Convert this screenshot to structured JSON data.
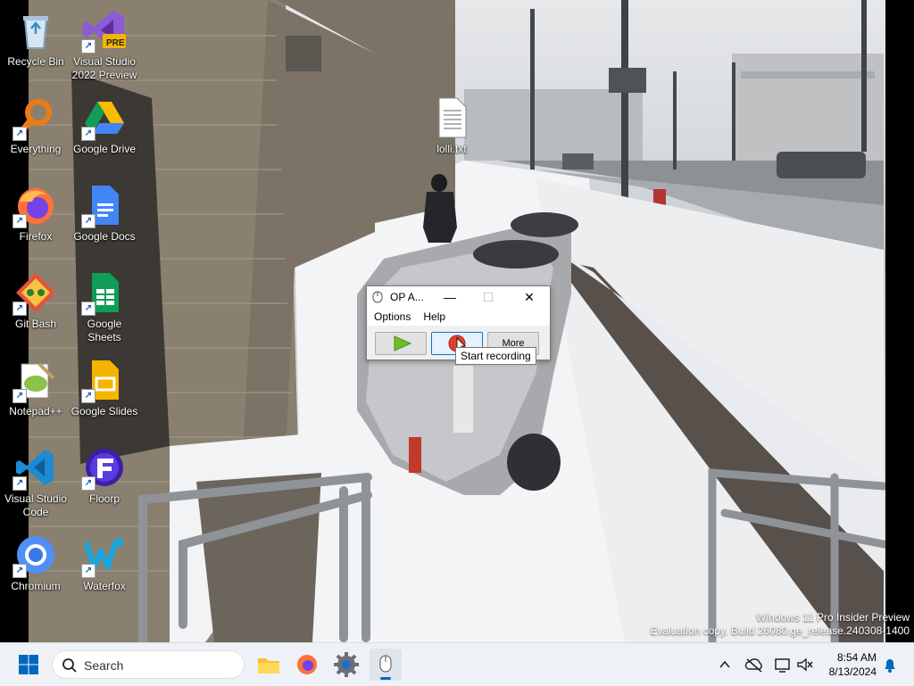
{
  "desktop": {
    "icons": [
      {
        "label": "Recycle Bin"
      },
      {
        "label": "Visual Studio 2022 Preview",
        "badge": "PRE"
      },
      {
        "label": "Everything"
      },
      {
        "label": "Google Drive"
      },
      {
        "label": "Firefox"
      },
      {
        "label": "Google Docs"
      },
      {
        "label": "Git Bash"
      },
      {
        "label": "Google Sheets"
      },
      {
        "label": "Notepad++"
      },
      {
        "label": "Google Slides"
      },
      {
        "label": "Visual Studio Code"
      },
      {
        "label": "Floorp"
      },
      {
        "label": "Chromium"
      },
      {
        "label": "Waterfox"
      }
    ],
    "file": {
      "label": "lolli.txt"
    }
  },
  "app_window": {
    "title": "OP A...",
    "menu": [
      "Options",
      "Help"
    ],
    "buttons": {
      "play": "play-icon",
      "record": "record-icon",
      "more": "More"
    },
    "tooltip": "Start recording"
  },
  "watermark": {
    "line1": "Windows 11 Pro Insider Preview",
    "line2": "Evaluation copy. Build 26080.ge_release.240308-1400"
  },
  "taskbar": {
    "search_placeholder": "Search",
    "time": "8:54 AM",
    "date": "8/13/2024"
  },
  "colors": {
    "accent": "#0067c0",
    "taskbar": "#eef2f7"
  }
}
